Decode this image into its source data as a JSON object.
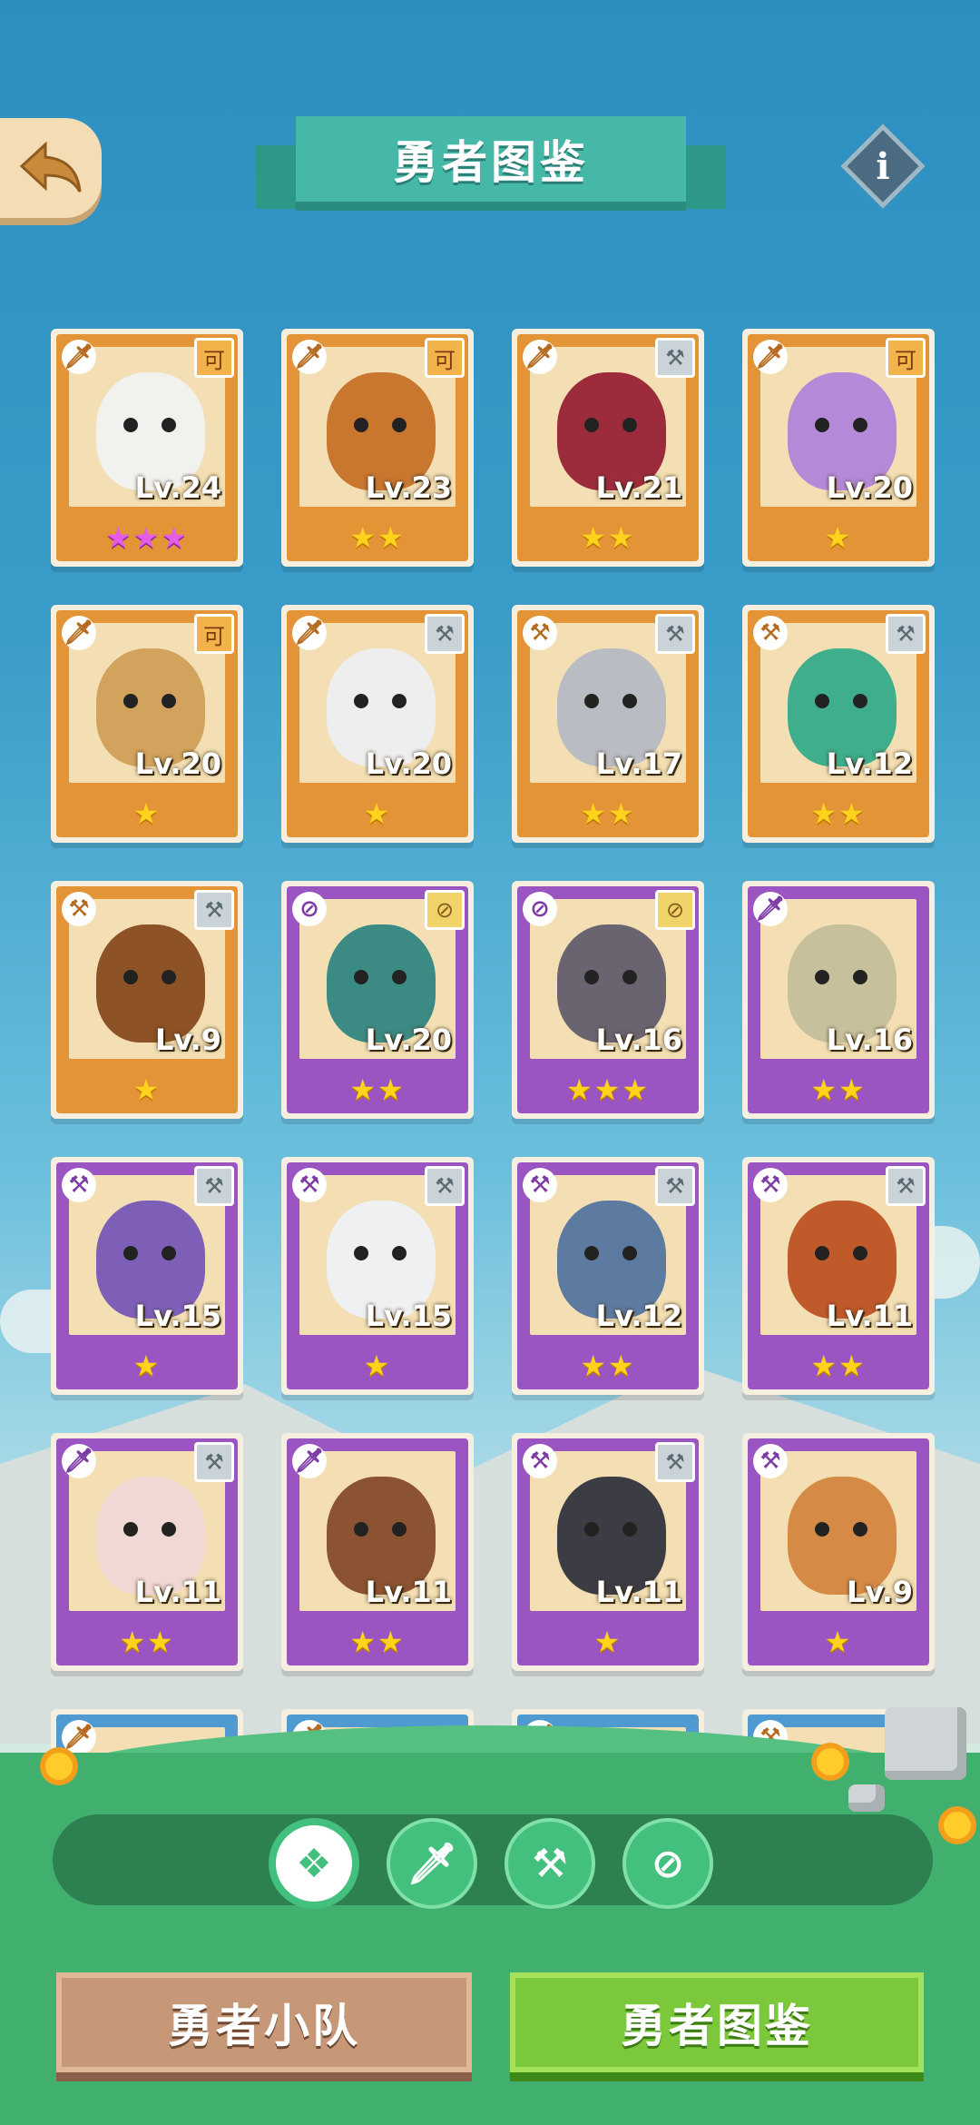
{
  "header": {
    "title": "勇者图鉴",
    "back_icon": "back-arrow-icon",
    "info_label": "i"
  },
  "colors": {
    "orange_card": "#e39437",
    "purple_card": "#9b55c2",
    "star": "#ffd21c",
    "pink_star": "#e45ce8",
    "title_banner": "#45b8a7"
  },
  "heroes": [
    {
      "level": "Lv.24",
      "stars": "★★★",
      "tier": "orange",
      "star_color": "pink",
      "class_icon": "sword-icon",
      "weapon_icon": "special-weapon-icon",
      "tint": "#f1f1ee"
    },
    {
      "level": "Lv.23",
      "stars": "★★",
      "tier": "orange",
      "star_color": "gold",
      "class_icon": "sword-icon",
      "weapon_icon": "special-weapon-icon",
      "tint": "#c9762f"
    },
    {
      "level": "Lv.21",
      "stars": "★★",
      "tier": "orange",
      "star_color": "gold",
      "class_icon": "sword-icon",
      "weapon_icon": "hammer-icon",
      "tint": "#9c2c3c"
    },
    {
      "level": "Lv.20",
      "stars": "★",
      "tier": "orange",
      "star_color": "gold",
      "class_icon": "sword-icon",
      "weapon_icon": "special-weapon-icon",
      "tint": "#b48ad8"
    },
    {
      "level": "Lv.20",
      "stars": "★",
      "tier": "orange",
      "star_color": "gold",
      "class_icon": "sword-icon",
      "weapon_icon": "special-weapon-icon",
      "tint": "#d2a35d"
    },
    {
      "level": "Lv.20",
      "stars": "★",
      "tier": "orange",
      "star_color": "gold",
      "class_icon": "sword-icon",
      "weapon_icon": "hammer-icon",
      "tint": "#eeeeee"
    },
    {
      "level": "Lv.17",
      "stars": "★★",
      "tier": "orange",
      "star_color": "gold",
      "class_icon": "hammer-class-icon",
      "weapon_icon": "hammer-icon",
      "tint": "#b9bcc2"
    },
    {
      "level": "Lv.12",
      "stars": "★★",
      "tier": "orange",
      "star_color": "gold",
      "class_icon": "hammer-class-icon",
      "weapon_icon": "hammer-icon",
      "tint": "#3fae8c"
    },
    {
      "level": "Lv.9",
      "stars": "★",
      "tier": "orange",
      "star_color": "gold",
      "class_icon": "hammer-class-icon",
      "weapon_icon": "hammer-icon",
      "tint": "#8d5226"
    },
    {
      "level": "Lv.20",
      "stars": "★★",
      "tier": "purple",
      "star_color": "gold",
      "class_icon": "compass-icon",
      "weapon_icon": "compass-weapon-icon",
      "tint": "#3c8a84"
    },
    {
      "level": "Lv.16",
      "stars": "★★★",
      "tier": "purple",
      "star_color": "gold",
      "class_icon": "compass-icon",
      "weapon_icon": "compass-weapon-icon",
      "tint": "#6a6470"
    },
    {
      "level": "Lv.16",
      "stars": "★★",
      "tier": "purple",
      "star_color": "gold",
      "class_icon": "sword-icon",
      "weapon_icon": "none",
      "tint": "#c7c09c"
    },
    {
      "level": "Lv.15",
      "stars": "★",
      "tier": "purple",
      "star_color": "gold",
      "class_icon": "hammer-class-icon",
      "weapon_icon": "hammer-icon",
      "tint": "#7e5fb8"
    },
    {
      "level": "Lv.15",
      "stars": "★",
      "tier": "purple",
      "star_color": "gold",
      "class_icon": "hammer-class-icon",
      "weapon_icon": "hammer-icon",
      "tint": "#eef0f2"
    },
    {
      "level": "Lv.12",
      "stars": "★★",
      "tier": "purple",
      "star_color": "gold",
      "class_icon": "hammer-class-icon",
      "weapon_icon": "hammer-icon",
      "tint": "#5d7aa0"
    },
    {
      "level": "Lv.11",
      "stars": "★★",
      "tier": "purple",
      "star_color": "gold",
      "class_icon": "hammer-class-icon",
      "weapon_icon": "hammer-icon",
      "tint": "#c05a2a"
    },
    {
      "level": "Lv.11",
      "stars": "★★",
      "tier": "purple",
      "star_color": "gold",
      "class_icon": "sword-icon",
      "weapon_icon": "hammer-icon",
      "tint": "#f0d8d4"
    },
    {
      "level": "Lv.11",
      "stars": "★★",
      "tier": "purple",
      "star_color": "gold",
      "class_icon": "sword-icon",
      "weapon_icon": "none",
      "tint": "#8b5331"
    },
    {
      "level": "Lv.11",
      "stars": "★",
      "tier": "purple",
      "star_color": "gold",
      "class_icon": "hammer-class-icon",
      "weapon_icon": "hammer-icon",
      "tint": "#3b3c44"
    },
    {
      "level": "Lv.9",
      "stars": "★",
      "tier": "purple",
      "star_color": "gold",
      "class_icon": "hammer-class-icon",
      "weapon_icon": "none",
      "tint": "#d58a45"
    },
    {
      "level": "",
      "stars": "",
      "tier": "blue",
      "star_color": "gold",
      "class_icon": "sword-icon",
      "weapon_icon": "none",
      "tint": "#a0a6ab"
    },
    {
      "level": "",
      "stars": "",
      "tier": "blue",
      "star_color": "gold",
      "class_icon": "sword-icon",
      "weapon_icon": "none",
      "tint": "#8c9398"
    },
    {
      "level": "",
      "stars": "",
      "tier": "blue",
      "star_color": "gold",
      "class_icon": "sword-icon",
      "weapon_icon": "none",
      "tint": "#3d4149"
    },
    {
      "level": "",
      "stars": "",
      "tier": "blue",
      "star_color": "gold",
      "class_icon": "hammer-class-icon",
      "weapon_icon": "none",
      "tint": "#e0b87a"
    }
  ],
  "filters": [
    {
      "name": "all-filter",
      "icon": "grid-diamond-icon",
      "glyph": "❖",
      "active": true
    },
    {
      "name": "sword-filter",
      "icon": "sword-icon",
      "glyph": "🗡",
      "active": false
    },
    {
      "name": "hammer-filter",
      "icon": "hammer-icon",
      "glyph": "⚒",
      "active": false
    },
    {
      "name": "compass-filter",
      "icon": "compass-icon",
      "glyph": "⊘",
      "active": false
    }
  ],
  "bottom_tabs": {
    "team": "勇者小队",
    "codex": "勇者图鉴"
  }
}
